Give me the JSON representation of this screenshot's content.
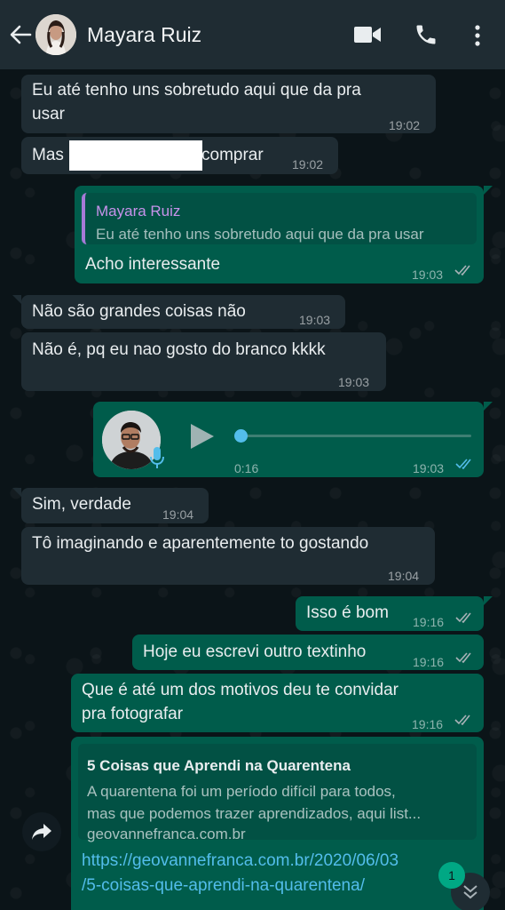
{
  "header": {
    "contact_name": "Mayara Ruiz"
  },
  "messages": [
    {
      "lines": [
        "Eu até tenho uns sobretudo aqui que da pra",
        "usar"
      ],
      "time": "19:02"
    },
    {
      "before": "Mas",
      "after": "comprar",
      "time": "19:02"
    },
    {
      "quote_name": "Mayara Ruiz",
      "quote_text": "Eu até tenho uns sobretudo aqui que da pra usar",
      "text": "Acho interessante",
      "time": "19:03"
    },
    {
      "text": "Não são grandes  coisas não",
      "time": "19:03"
    },
    {
      "text": "Não é,  pq eu nao gosto do branco kkkk",
      "time": "19:03"
    },
    {
      "duration": "0:16",
      "time": "19:03"
    },
    {
      "text": "Sim, verdade",
      "time": "19:04"
    },
    {
      "text": "Tô imaginando e aparentemente to gostando",
      "time": "19:04"
    },
    {
      "text": "Isso é bom",
      "time": "19:16"
    },
    {
      "text": "Hoje eu escrevi outro textinho",
      "time": "19:16"
    },
    {
      "lines": [
        "Que é até um dos motivos deu te convidar",
        "pra fotografar"
      ],
      "time": "19:16"
    },
    {
      "link_title": "5 Coisas que Aprendi na Quarentena",
      "link_desc": [
        "A quarentena foi um período difícil para todos,",
        "mas que podemos trazer aprendizados, aqui list..."
      ],
      "link_domain": "geovannefranca.com.br",
      "url_lines": [
        "https://geovannefranca.com.br/2020/06/03",
        "/5-coisas-que-aprendi-na-quarentena/"
      ],
      "time": "19:16"
    }
  ],
  "unread_badge": "1",
  "colors": {
    "header": "#1f2c33",
    "incoming": "#1f2c33",
    "outgoing": "#005c4b",
    "quote_name": "#c792ea",
    "link": "#53bdeb",
    "read_tick": "#53bdeb"
  }
}
